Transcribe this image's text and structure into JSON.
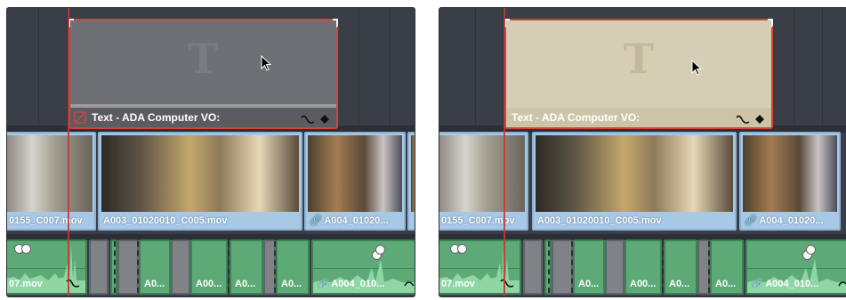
{
  "colors": {
    "timeline_bg": "#3a3e47",
    "title_clip_left": "#6f7076",
    "title_clip_right": "#d6ceb4",
    "selection_outline": "#d4443a",
    "video_clip": "#a8c9e6",
    "audio_clip": "#5daa77",
    "playhead": "#c23a35"
  },
  "panels": [
    {
      "title_clip": {
        "glyph": "T",
        "label": "Text - ADA Computer VO:",
        "icons": [
          "curve-icon",
          "keyframe-icon"
        ]
      },
      "video_clips": [
        {
          "label": "0155_C007.mov"
        },
        {
          "label": "A003_01020010_C005.mov"
        },
        {
          "label": "A004_01020...",
          "link_icon": true
        }
      ],
      "audio_clips": [
        {
          "label": "07.mov"
        },
        {
          "label": "A0..."
        },
        {
          "label": "A00..."
        },
        {
          "label": "A0..."
        },
        {
          "label": "A0..."
        },
        {
          "label": "A004_010...",
          "link_icon": true
        }
      ]
    },
    {
      "title_clip": {
        "glyph": "T",
        "label": "Text - ADA Computer VO:",
        "icons": [
          "curve-icon",
          "keyframe-icon"
        ]
      },
      "video_clips": [
        {
          "label": "0155_C007.mov"
        },
        {
          "label": "A003_01020010_C005.mov"
        },
        {
          "label": "A004_01020...",
          "link_icon": true
        }
      ],
      "audio_clips": [
        {
          "label": "07.mov"
        },
        {
          "label": "A0..."
        },
        {
          "label": "A00..."
        },
        {
          "label": "A0..."
        },
        {
          "label": "A0..."
        },
        {
          "label": "A004_010...",
          "link_icon": true
        }
      ]
    }
  ]
}
